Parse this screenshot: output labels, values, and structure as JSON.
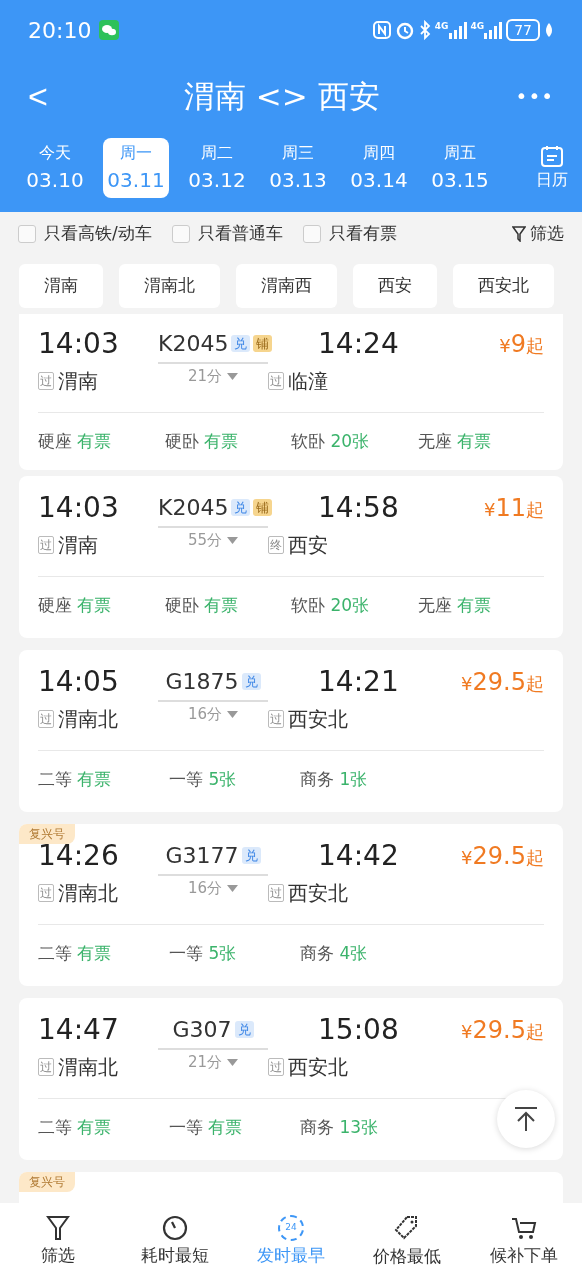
{
  "status_bar": {
    "time": "20:10",
    "network_1": "4G",
    "network_2": "4G",
    "battery": "77"
  },
  "header": {
    "back": "<",
    "title": "渭南 <> 西安",
    "more": "•••"
  },
  "dates": [
    {
      "weekday": "今天",
      "date": "03.10",
      "selected": false
    },
    {
      "weekday": "周一",
      "date": "03.11",
      "selected": true
    },
    {
      "weekday": "周二",
      "date": "03.12",
      "selected": false
    },
    {
      "weekday": "周三",
      "date": "03.13",
      "selected": false
    },
    {
      "weekday": "周四",
      "date": "03.14",
      "selected": false
    },
    {
      "weekday": "周五",
      "date": "03.15",
      "selected": false
    }
  ],
  "calendar": {
    "label": "日历"
  },
  "filters": [
    {
      "label": "只看高铁/动车",
      "checked": false
    },
    {
      "label": "只看普通车",
      "checked": false
    },
    {
      "label": "只看有票",
      "checked": false
    }
  ],
  "filter_button": "筛选",
  "stations": [
    "渭南",
    "渭南北",
    "渭南西",
    "西安",
    "西安北"
  ],
  "trains": [
    {
      "depart": "14:03",
      "number": "K2045",
      "badges": [
        {
          "text": "兑",
          "kind": "exchange"
        },
        {
          "text": "铺",
          "kind": "berth"
        }
      ],
      "arrive": "14:24",
      "from_mark": "过",
      "from": "渭南",
      "duration": "21分",
      "to_mark": "过",
      "to": "临潼",
      "currency": "¥",
      "price": "9",
      "price_suffix": "起",
      "seats": [
        {
          "class": "硬座",
          "avail": "有票"
        },
        {
          "class": "硬卧",
          "avail": "有票"
        },
        {
          "class": "软卧",
          "avail": "20张"
        },
        {
          "class": "无座",
          "avail": "有票"
        }
      ]
    },
    {
      "depart": "14:03",
      "number": "K2045",
      "badges": [
        {
          "text": "兑",
          "kind": "exchange"
        },
        {
          "text": "铺",
          "kind": "berth"
        }
      ],
      "arrive": "14:58",
      "from_mark": "过",
      "from": "渭南",
      "duration": "55分",
      "to_mark": "终",
      "to": "西安",
      "currency": "¥",
      "price": "11",
      "price_suffix": "起",
      "seats": [
        {
          "class": "硬座",
          "avail": "有票"
        },
        {
          "class": "硬卧",
          "avail": "有票"
        },
        {
          "class": "软卧",
          "avail": "20张"
        },
        {
          "class": "无座",
          "avail": "有票"
        }
      ]
    },
    {
      "depart": "14:05",
      "number": "G1875",
      "badges": [
        {
          "text": "兑",
          "kind": "exchange"
        }
      ],
      "arrive": "14:21",
      "from_mark": "过",
      "from": "渭南北",
      "duration": "16分",
      "to_mark": "过",
      "to": "西安北",
      "currency": "¥",
      "price": "29.5",
      "price_suffix": "起",
      "seats": [
        {
          "class": "二等",
          "avail": "有票"
        },
        {
          "class": "一等",
          "avail": "5张"
        },
        {
          "class": "商务",
          "avail": "1张"
        }
      ]
    },
    {
      "tag": "复兴号",
      "depart": "14:26",
      "number": "G3177",
      "badges": [
        {
          "text": "兑",
          "kind": "exchange"
        }
      ],
      "arrive": "14:42",
      "from_mark": "过",
      "from": "渭南北",
      "duration": "16分",
      "to_mark": "过",
      "to": "西安北",
      "currency": "¥",
      "price": "29.5",
      "price_suffix": "起",
      "seats": [
        {
          "class": "二等",
          "avail": "有票"
        },
        {
          "class": "一等",
          "avail": "5张"
        },
        {
          "class": "商务",
          "avail": "4张"
        }
      ]
    },
    {
      "depart": "14:47",
      "number": "G307",
      "badges": [
        {
          "text": "兑",
          "kind": "exchange"
        }
      ],
      "arrive": "15:08",
      "from_mark": "过",
      "from": "渭南北",
      "duration": "21分",
      "to_mark": "过",
      "to": "西安北",
      "currency": "¥",
      "price": "29.5",
      "price_suffix": "起",
      "seats": [
        {
          "class": "二等",
          "avail": "有票"
        },
        {
          "class": "一等",
          "avail": "有票"
        },
        {
          "class": "商务",
          "avail": "13张"
        }
      ]
    },
    {
      "tag": "复兴号"
    }
  ],
  "bottom_tabs": [
    {
      "label": "筛选",
      "kind": "filter",
      "selected": false
    },
    {
      "label": "耗时最短",
      "kind": "timer",
      "selected": false
    },
    {
      "label": "发时最早",
      "kind": "clock",
      "icon_text": "24",
      "selected": true
    },
    {
      "label": "价格最低",
      "kind": "tag",
      "selected": false
    },
    {
      "label": "候补下单",
      "kind": "cart",
      "selected": false
    }
  ]
}
